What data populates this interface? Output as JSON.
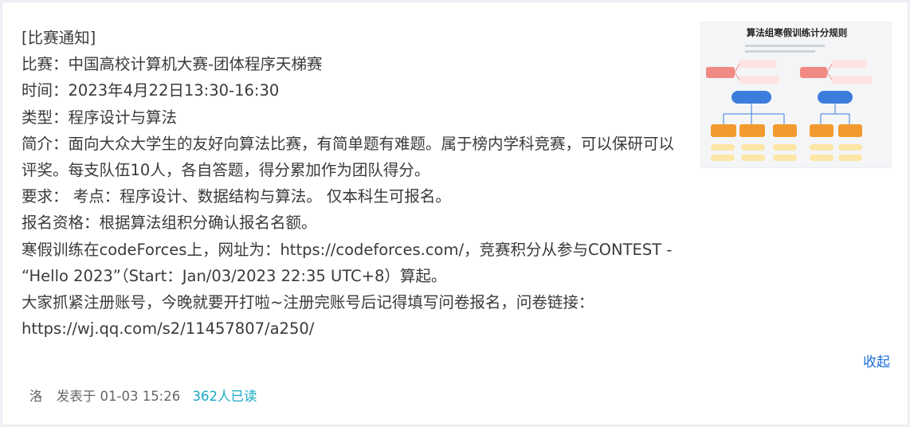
{
  "notice": {
    "lines": [
      "[比赛通知]",
      "比赛：中国高校计算机大赛-团体程序天梯赛",
      "时间：2023年4月22日13:30-16:30",
      "类型：程序设计与算法",
      "简介：面向大众大学生的友好向算法比赛，有简单题有难题。属于榜内学科竞赛，可以保研可以评奖。每支队伍10人，各自答题，得分累加作为团队得分。",
      "要求：  考点：程序设计、数据结构与算法。 仅本科生可报名。",
      "报名资格：根据算法组积分确认报名名额。",
      "寒假训练在codeForces上，网址为：https://codeforces.com/，竞赛积分从参与CONTEST - “Hello 2023”（Start：Jan/03/2023 22:35 UTC+8）算起。",
      "大家抓紧注册账号，今晚就要开打啦~注册完账号后记得填写问卷报名，问卷链接：https://wj.qq.com/s2/11457807/a250/"
    ]
  },
  "thumbnail": {
    "title": "算法组寒假训练计分规则",
    "icon": "flowchart-image"
  },
  "actions": {
    "collapse_label": "收起"
  },
  "footer": {
    "author": "洛",
    "posted_prefix": "发表于",
    "posted_time": "01-03 15:26",
    "read_count": "362人已读"
  },
  "colors": {
    "link_blue": "#1e6fd9",
    "read_teal": "#17a9c4",
    "text": "#3a3a3a"
  }
}
